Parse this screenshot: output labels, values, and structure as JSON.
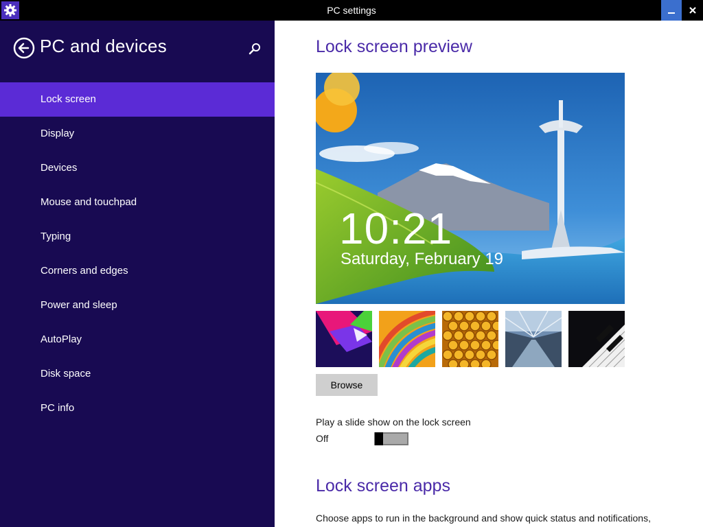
{
  "window": {
    "title": "PC settings"
  },
  "sidebar": {
    "section_title": "PC and devices",
    "items": [
      {
        "label": "Lock screen",
        "active": true
      },
      {
        "label": "Display",
        "active": false
      },
      {
        "label": "Devices",
        "active": false
      },
      {
        "label": "Mouse and touchpad",
        "active": false
      },
      {
        "label": "Typing",
        "active": false
      },
      {
        "label": "Corners and edges",
        "active": false
      },
      {
        "label": "Power and sleep",
        "active": false
      },
      {
        "label": "AutoPlay",
        "active": false
      },
      {
        "label": "Disk space",
        "active": false
      },
      {
        "label": "PC info",
        "active": false
      }
    ]
  },
  "main": {
    "preview_heading": "Lock screen preview",
    "preview_time": "10:21",
    "preview_date": "Saturday, February 19",
    "thumbnails": [
      "abstract-geometric",
      "colorful-stripes",
      "honeycomb",
      "train-station",
      "piano-keys"
    ],
    "browse_label": "Browse",
    "slideshow_label": "Play a slide show on the lock screen",
    "slideshow_state": "Off",
    "apps_heading": "Lock screen apps",
    "apps_description": "Choose apps to run in the background and show quick status and notifications,"
  },
  "colors": {
    "titlebar_bg": "#000000",
    "sidebar_bg": "#180a52",
    "active_item_bg": "#5b2bd6",
    "heading_color": "#4a2aa8",
    "minimize_bg": "#3b6fce"
  },
  "icons": {
    "app": "gear-icon",
    "minimize": "minimize-icon",
    "close": "close-icon",
    "back": "back-arrow-icon",
    "search": "search-icon"
  }
}
